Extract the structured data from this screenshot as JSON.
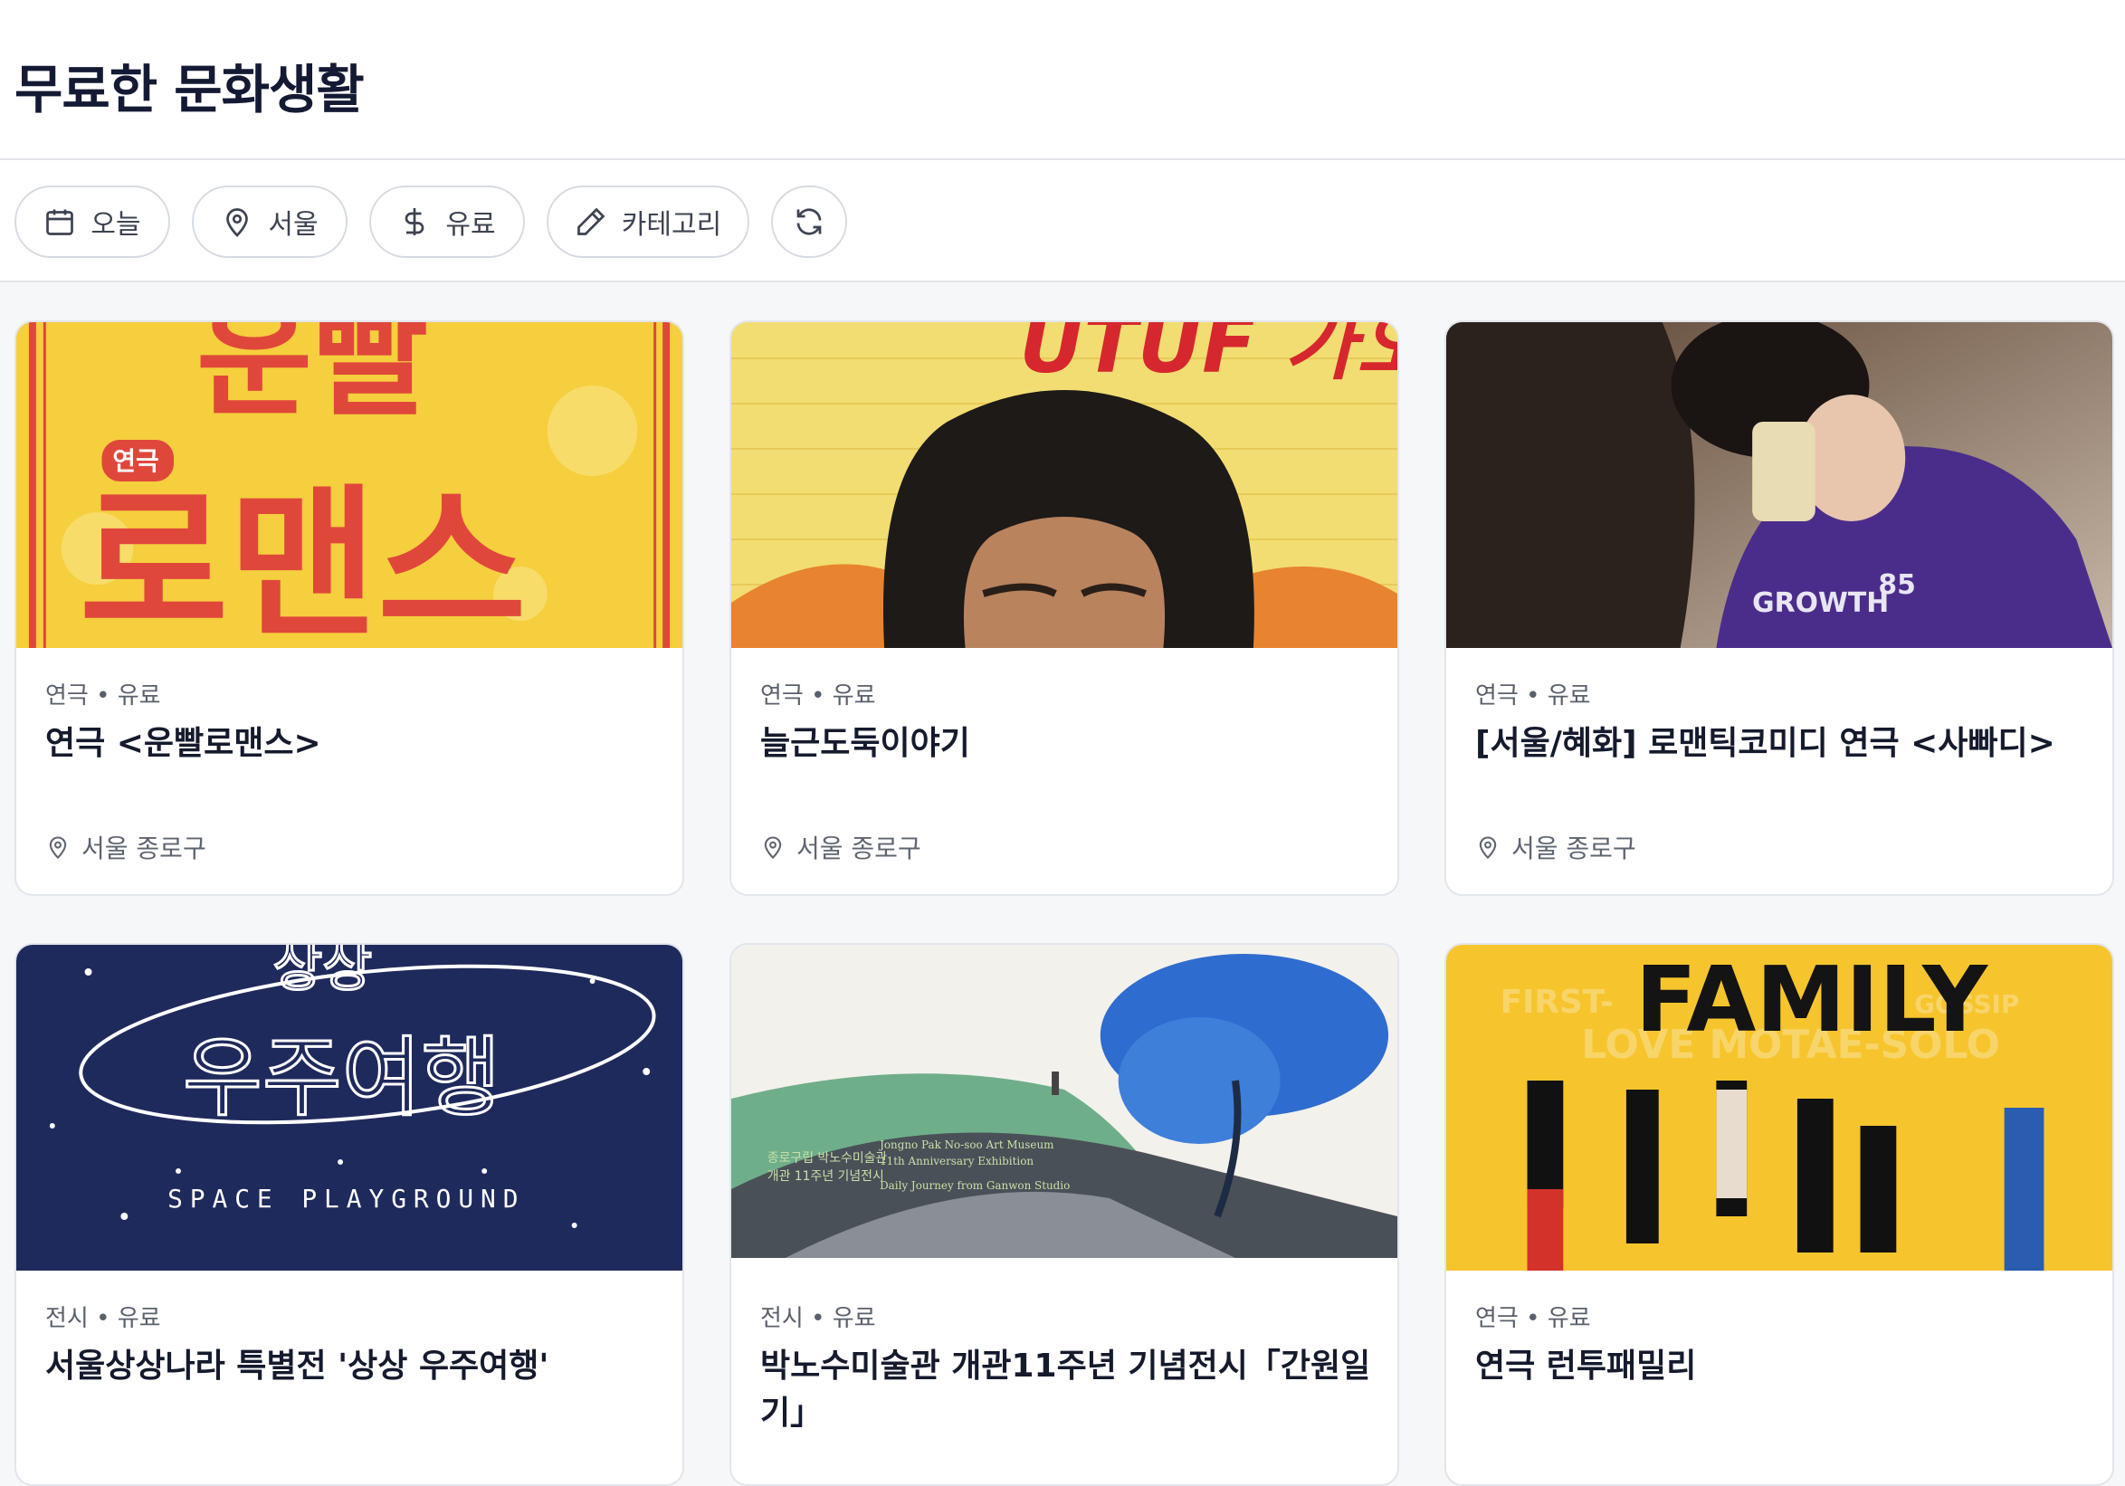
{
  "page": {
    "title": "무료한 문화생활"
  },
  "filters": [
    {
      "label": "오늘",
      "icon": "calendar-icon"
    },
    {
      "label": "서울",
      "icon": "map-pin-icon"
    },
    {
      "label": "유료",
      "icon": "dollar-icon"
    },
    {
      "label": "카테고리",
      "icon": "pen-icon"
    }
  ],
  "refresh": {
    "icon": "refresh-icon"
  },
  "cards": [
    {
      "meta": "연극 • 유료",
      "title": "연극 <운빨로맨스>",
      "location": "서울 종로구",
      "poster": {
        "text": [
          "운빨",
          "연극",
          "로맨스"
        ]
      }
    },
    {
      "meta": "연극 • 유료",
      "title": "늘근도둑이야기",
      "location": "서울 종로구",
      "poster": {
        "text": [
          "UTUF 가오"
        ]
      }
    },
    {
      "meta": "연극 • 유료",
      "title": "[서울/혜화] 로맨틱코미디 연극 <사빠디>",
      "location": "서울 종로구",
      "poster": {
        "text": [
          "GROWTH",
          "85"
        ]
      }
    },
    {
      "meta": "전시 • 유료",
      "title": "서울상상나라 특별전 '상상 우주여행'",
      "poster": {
        "text": [
          "상상",
          "우주여행",
          "SPACE PLAYGROUND"
        ]
      }
    },
    {
      "meta": "전시 • 유료",
      "title": "박노수미술관 개관11주년 기념전시「간원일기」",
      "poster": {
        "text": [
          "종로구립 박노수미술관",
          "개관 11주년 기념전시",
          "Jongno Pak No-soo Art Museum",
          "11th Anniversary Exhibition",
          "Daily Journey from Ganwon Studio"
        ]
      }
    },
    {
      "meta": "연극 • 유료",
      "title": "연극 런투패밀리",
      "poster": {
        "text": [
          "FAMILY",
          "FIRST-",
          "GOSSIP",
          "LOVE MOTAE-SOLO"
        ]
      }
    }
  ],
  "colors": {
    "title": "#141a33",
    "accent_red": "#e0473b",
    "yellow": "#f5cf3d",
    "navy": "#1f2a5c"
  }
}
